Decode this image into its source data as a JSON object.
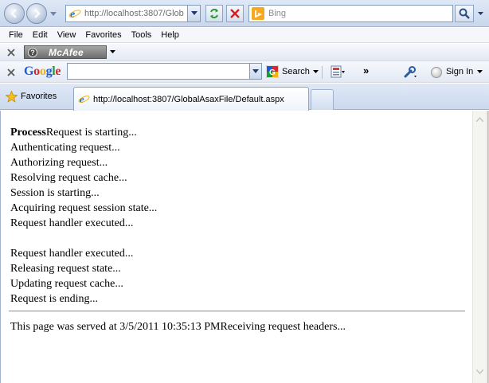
{
  "browser": {
    "address": "http://localhost:3807/Glob",
    "search_placeholder": "Bing",
    "icons": {
      "back": "back-arrow-icon",
      "forward": "forward-arrow-icon",
      "refresh": "refresh-icon",
      "stop": "stop-icon",
      "search": "magnifier-icon"
    }
  },
  "menu": {
    "items": [
      "File",
      "Edit",
      "View",
      "Favorites",
      "Tools",
      "Help"
    ]
  },
  "mcafee": {
    "label": "McAfee",
    "brand_color": "#6d6d6d"
  },
  "google_toolbar": {
    "logo": [
      "G",
      "o",
      "o",
      "g",
      "l",
      "e"
    ],
    "search_label": "Search",
    "more_label": "»",
    "signin_label": "Sign In",
    "colors": {
      "blue": "#1a5cd7",
      "red": "#d8262f",
      "yellow": "#f2b20f",
      "green": "#199a3c"
    }
  },
  "tabs": {
    "favorites_label": "Favorites",
    "active_tab_title": "http://localhost:3807/GlobalAsaxFile/Default.aspx"
  },
  "page": {
    "first_line_bold": "Process",
    "first_line_rest": "Request is starting...",
    "lines_group1": [
      "Authenticating request...",
      "Authorizing request...",
      "Resolving request cache...",
      "Session is starting...",
      "Acquiring request session state...",
      "Request handler executed..."
    ],
    "lines_group2": [
      "Request handler executed...",
      "Releasing request state...",
      "Updating request cache...",
      "Request is ending..."
    ],
    "footer": "This page was served at 3/5/2011 10:35:13 PMReceiving request headers..."
  }
}
